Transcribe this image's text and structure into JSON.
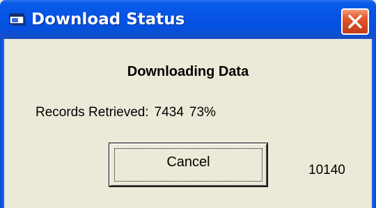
{
  "window": {
    "title": "Download Status",
    "title_icon": "window-app-icon",
    "close_icon": "close-icon",
    "titlebar_color": "#0654e6",
    "close_color": "#e4572d",
    "body_color": "#ece9d8"
  },
  "dialog": {
    "heading": "Downloading Data",
    "records_label": "Records Retrieved:",
    "records_count": "7434",
    "records_percent": "73%",
    "cancel_label": "Cancel",
    "total_count": "10140"
  }
}
